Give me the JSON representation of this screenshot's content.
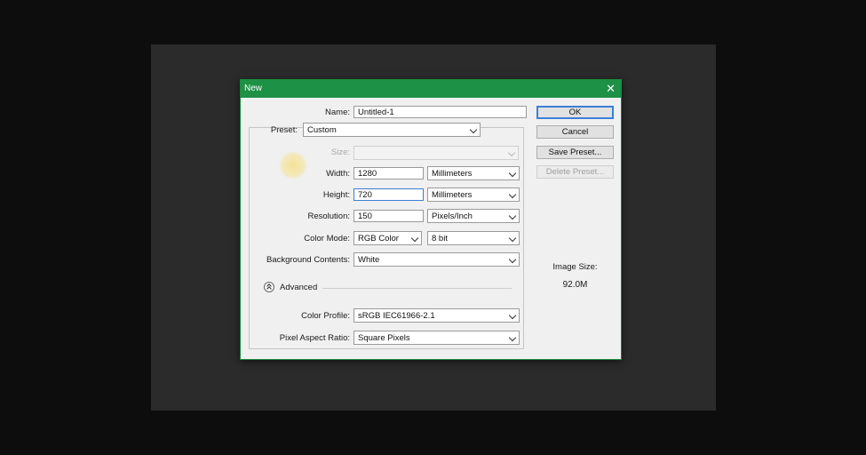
{
  "dialog": {
    "title": "New",
    "close_glyph": "✕"
  },
  "form": {
    "name_label": "Name:",
    "name_value": "Untitled-1",
    "preset_label": "Preset:",
    "preset_value": "Custom",
    "size_label": "Size:",
    "size_value": "",
    "width_label": "Width:",
    "width_value": "1280",
    "width_unit": "Millimeters",
    "height_label": "Height:",
    "height_value": "720",
    "height_unit": "Millimeters",
    "resolution_label": "Resolution:",
    "resolution_value": "150",
    "resolution_unit": "Pixels/Inch",
    "color_mode_label": "Color Mode:",
    "color_mode_value": "RGB Color",
    "bit_depth_value": "8 bit",
    "background_label": "Background Contents:",
    "background_value": "White",
    "advanced_label": "Advanced",
    "color_profile_label": "Color Profile:",
    "color_profile_value": "sRGB IEC61966-2.1",
    "pixel_aspect_label": "Pixel Aspect Ratio:",
    "pixel_aspect_value": "Square Pixels"
  },
  "buttons": {
    "ok": "OK",
    "cancel": "Cancel",
    "save_preset": "Save Preset...",
    "delete_preset": "Delete Preset..."
  },
  "image_size": {
    "label": "Image Size:",
    "value": "92.0M"
  },
  "colors": {
    "title_bar": "#1d9145",
    "dialog_bg": "#f0f0f0",
    "focus_border": "#3b7fd6"
  }
}
